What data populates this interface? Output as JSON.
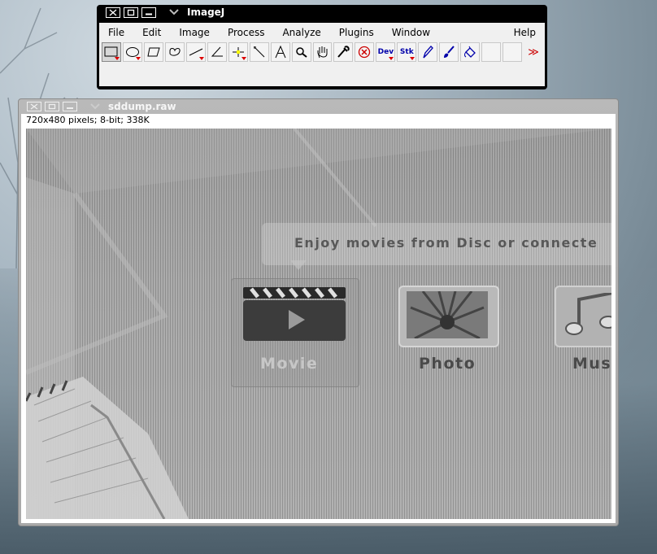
{
  "imagej_window": {
    "title": "ImageJ",
    "menus": [
      "File",
      "Edit",
      "Image",
      "Process",
      "Analyze",
      "Plugins",
      "Window"
    ],
    "help_menu": "Help",
    "tools": [
      {
        "name": "rectangle-tool",
        "icon": "rect",
        "has_arrow": true,
        "selected": true
      },
      {
        "name": "oval-tool",
        "icon": "oval",
        "has_arrow": true
      },
      {
        "name": "polygon-tool",
        "icon": "polygon"
      },
      {
        "name": "freehand-tool",
        "icon": "freehand"
      },
      {
        "name": "line-tool",
        "icon": "line",
        "has_arrow": true
      },
      {
        "name": "angle-tool",
        "icon": "angle"
      },
      {
        "name": "point-tool",
        "icon": "point",
        "has_arrow": true
      },
      {
        "name": "wand-tool",
        "icon": "wand"
      },
      {
        "name": "text-tool",
        "icon": "text"
      },
      {
        "name": "magnifier-tool",
        "icon": "magnifier"
      },
      {
        "name": "hand-tool",
        "icon": "hand"
      },
      {
        "name": "dropper-tool",
        "icon": "dropper"
      },
      {
        "name": "close-roi-tool",
        "icon": "x-circle"
      },
      {
        "name": "dev-menu-tool",
        "icon": "Dev",
        "has_arrow": true
      },
      {
        "name": "stack-tool",
        "icon": "Stk",
        "has_arrow": true
      },
      {
        "name": "pencil-tool",
        "icon": "pencil"
      },
      {
        "name": "brush-tool",
        "icon": "brush"
      },
      {
        "name": "flood-fill-tool",
        "icon": "fill"
      },
      {
        "name": "empty-slot-1",
        "icon": ""
      },
      {
        "name": "empty-slot-2",
        "icon": ""
      }
    ],
    "more_tools_label": "≫"
  },
  "image_window": {
    "title": "sddump.raw",
    "info": "720x480 pixels; 8-bit; 338K",
    "content": {
      "banner_text": "Enjoy movies from Disc or connecte",
      "tiles": [
        {
          "label": "Movie"
        },
        {
          "label": "Photo"
        },
        {
          "label": "Mus"
        }
      ]
    }
  },
  "colors": {
    "titlebar_main": "#000000",
    "titlebar_image": "#a9a9a9",
    "toolbar_bg": "#f0f0f0",
    "accent_red": "#cc0000",
    "accent_blue": "#0000aa"
  }
}
